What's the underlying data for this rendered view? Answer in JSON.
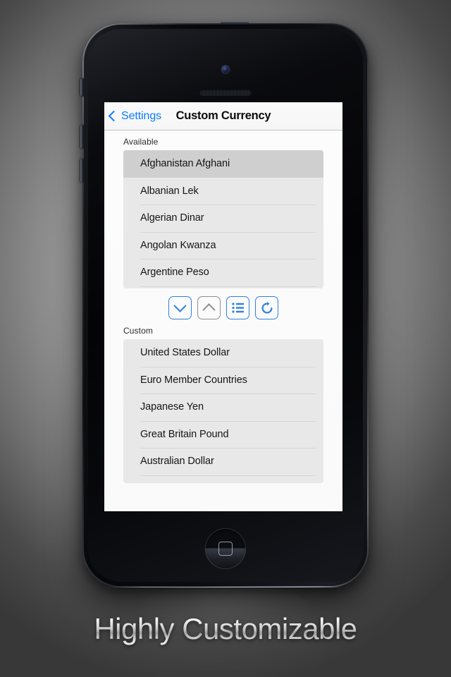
{
  "caption": "Highly Customizable",
  "device": {
    "name": "iphone-5-black",
    "icons": {
      "camera": "front-camera-icon",
      "earpiece": "earpiece-speaker-icon",
      "home": "home-button-icon"
    }
  },
  "nav": {
    "back_label": "Settings",
    "title": "Custom Currency",
    "back_icon": "chevron-left-icon",
    "accent_color": "#0a7cff"
  },
  "sections": {
    "available": {
      "label": "Available",
      "rows": [
        "Afghanistan Afghani",
        "Albanian Lek",
        "Algerian Dinar",
        "Angolan Kwanza",
        "Argentine Peso"
      ],
      "selected_index": 0
    },
    "custom": {
      "label": "Custom",
      "rows": [
        "United States Dollar",
        "Euro Member Countries",
        "Japanese Yen",
        "Great Britain Pound",
        "Australian Dollar"
      ],
      "selected_index": -1
    }
  },
  "toolbar": {
    "buttons": [
      {
        "icon": "chevron-down-icon",
        "name": "move-down-button",
        "enabled": true,
        "color": "#2f7fe0"
      },
      {
        "icon": "chevron-up-icon",
        "name": "move-up-button",
        "enabled": false,
        "color": "#8e8e8e"
      },
      {
        "icon": "list-icon",
        "name": "reorder-button",
        "enabled": true,
        "color": "#2f7fe0"
      },
      {
        "icon": "refresh-icon",
        "name": "reset-button",
        "enabled": true,
        "color": "#2f7fe0"
      }
    ]
  }
}
